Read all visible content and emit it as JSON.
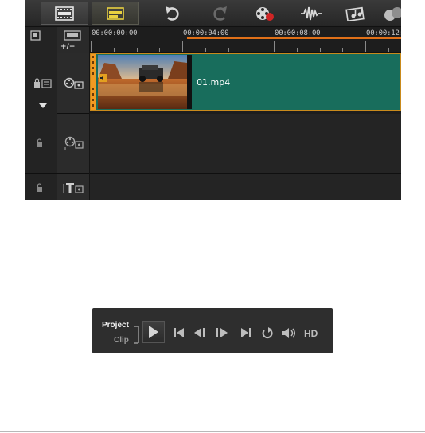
{
  "timeline": {
    "ruler": {
      "timecodes": [
        "00:00:00:00",
        "00:00:04:00",
        "00:00:08:00",
        "00:00:12:"
      ]
    },
    "track_control": "+/−",
    "clip": {
      "name": "01.mp4"
    }
  },
  "toolbar": {
    "icons": [
      "storyboard-view-icon",
      "timeline-view-icon",
      "undo-icon",
      "redo-icon",
      "record-capture-icon",
      "sound-mixer-icon",
      "auto-music-icon",
      "track-manager-icon"
    ]
  },
  "player": {
    "mode_project": "Project",
    "mode_clip": "Clip",
    "hd_label": "HD"
  },
  "colors": {
    "clip_fill": "#186d5c",
    "clip_border": "#c98a1c",
    "playrange": "#e07018",
    "panel_bg": "#1d1d1d"
  }
}
